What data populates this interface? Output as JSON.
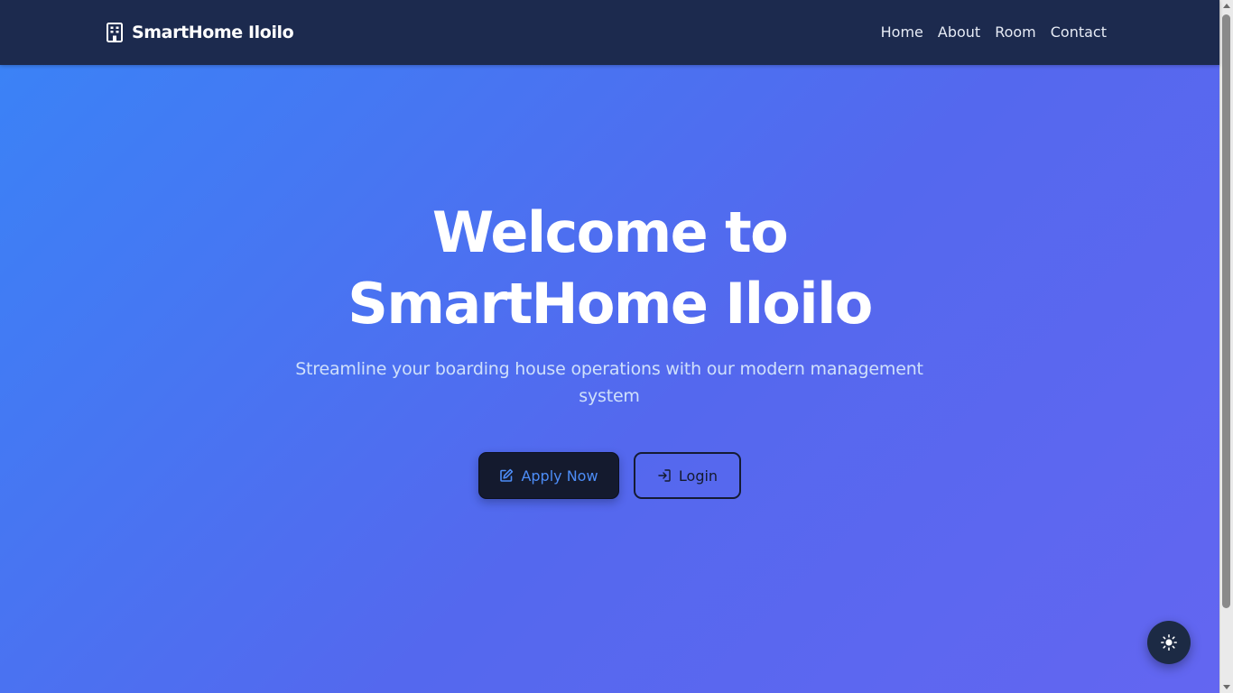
{
  "brand": {
    "name": "SmartHome Iloilo",
    "icon": "building-icon"
  },
  "nav": {
    "links": [
      {
        "label": "Home"
      },
      {
        "label": "About"
      },
      {
        "label": "Room"
      },
      {
        "label": "Contact"
      }
    ]
  },
  "hero": {
    "title_line1": "Welcome to",
    "title_line2": "SmartHome Iloilo",
    "subtitle": "Streamline your boarding house operations with our modern management system"
  },
  "buttons": {
    "apply": {
      "label": "Apply Now",
      "icon": "edit-icon"
    },
    "login": {
      "label": "Login",
      "icon": "sign-in-icon"
    }
  },
  "theme_toggle": {
    "icon": "sun-icon"
  },
  "colors": {
    "navbar": "#1c2a4e",
    "gradient_start": "#3b82f6",
    "gradient_end": "#6366f1",
    "apply_bg": "#141a2e",
    "apply_text": "#4d8df7"
  }
}
